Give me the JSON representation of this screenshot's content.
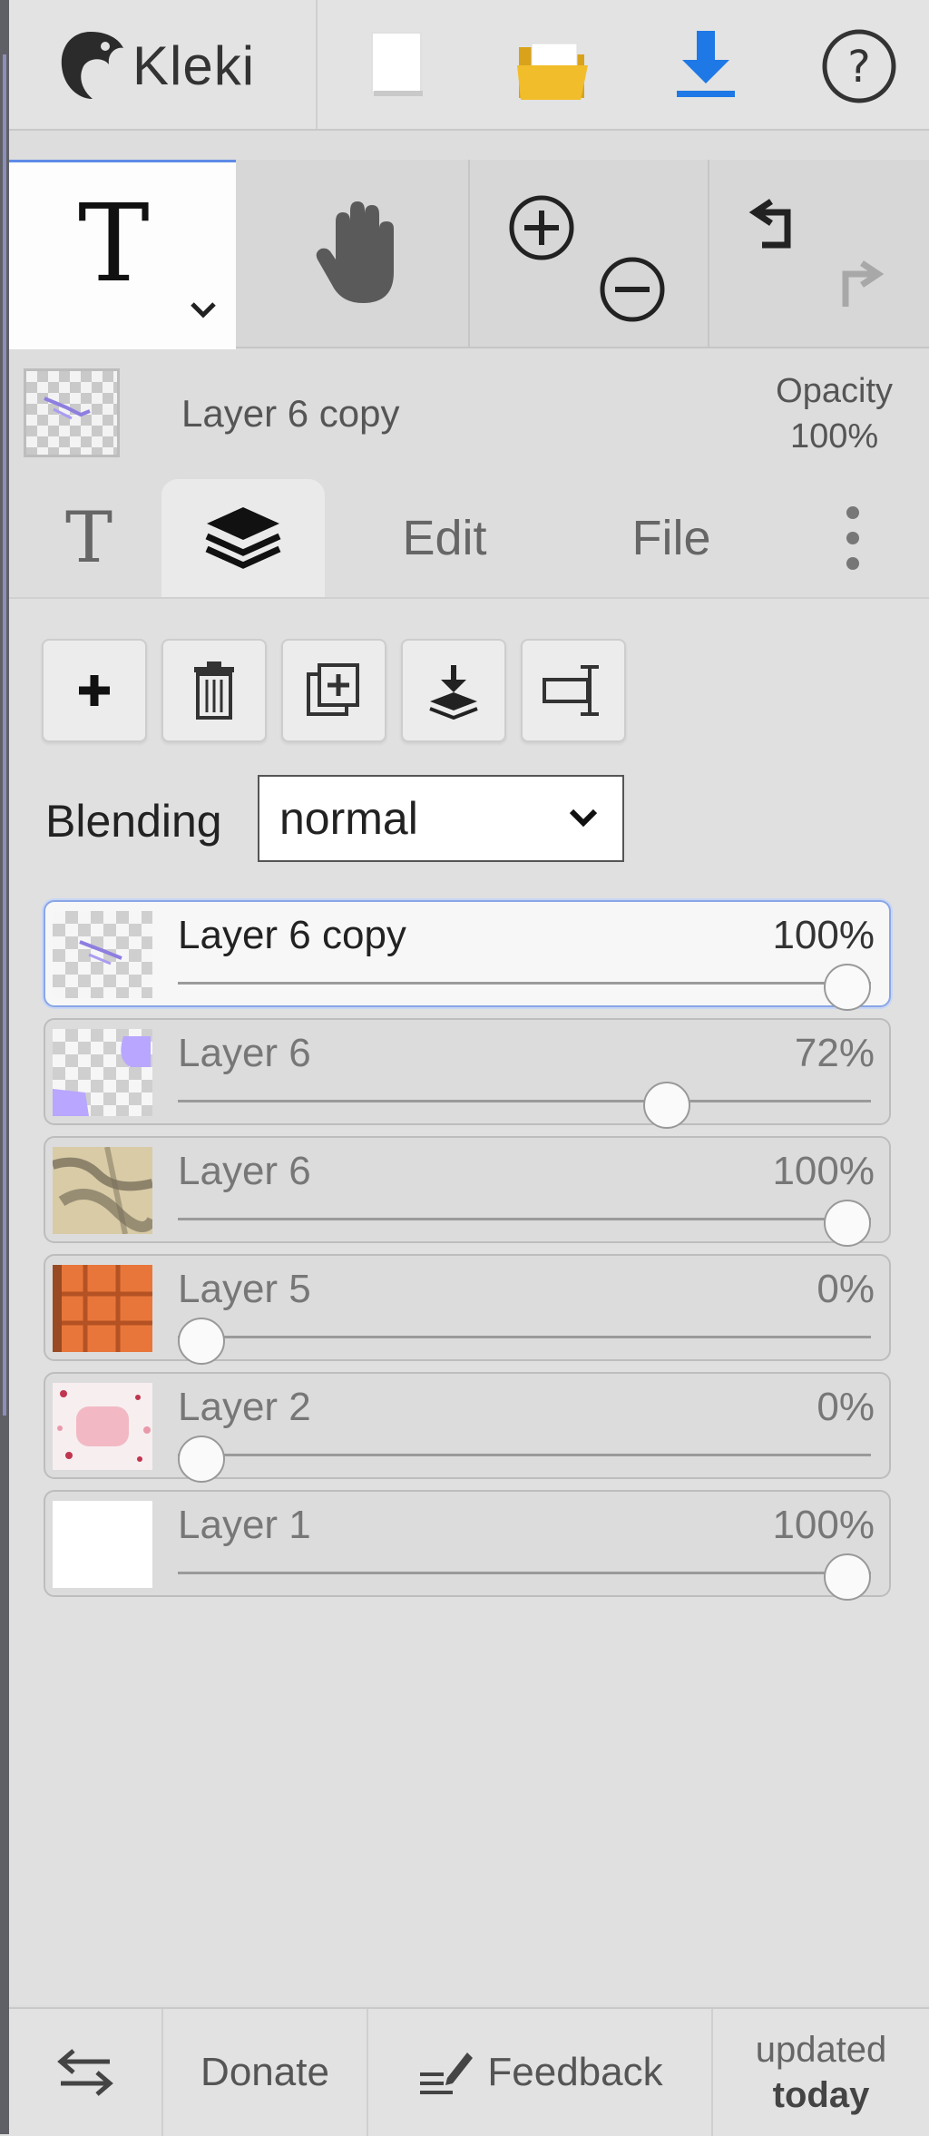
{
  "app": {
    "name": "Kleki"
  },
  "toolbar": {
    "new_label": "New image",
    "open_label": "Open",
    "download_label": "Save",
    "help_label": "Help"
  },
  "tools": {
    "active": "T",
    "hand": "hand"
  },
  "current_layer": {
    "name": "Layer 6 copy",
    "opacity_label": "Opacity",
    "opacity_value": "100%"
  },
  "tabs": [
    {
      "label": "T"
    },
    {
      "label": "layers"
    },
    {
      "label": "Edit"
    },
    {
      "label": "File"
    }
  ],
  "layer_actions": [
    "add",
    "delete",
    "duplicate",
    "merge-down",
    "rename"
  ],
  "blending": {
    "label": "Blending",
    "value": "normal"
  },
  "layers": [
    {
      "name": "Layer 6 copy",
      "opacity": "100%",
      "level": 1.0,
      "selected": true
    },
    {
      "name": "Layer 6",
      "opacity": "72%",
      "level": 0.72,
      "selected": false
    },
    {
      "name": "Layer 6",
      "opacity": "100%",
      "level": 1.0,
      "selected": false
    },
    {
      "name": "Layer 5",
      "opacity": "0%",
      "level": 0.0,
      "selected": false
    },
    {
      "name": "Layer 2",
      "opacity": "0%",
      "level": 0.0,
      "selected": false
    },
    {
      "name": "Layer 1",
      "opacity": "100%",
      "level": 1.0,
      "selected": false
    }
  ],
  "footer": {
    "donate": "Donate",
    "feedback": "Feedback",
    "updated_line1": "updated",
    "updated_line2": "today"
  },
  "colors": {
    "accent": "#1e78e6",
    "folder": "#f2bd2a"
  }
}
